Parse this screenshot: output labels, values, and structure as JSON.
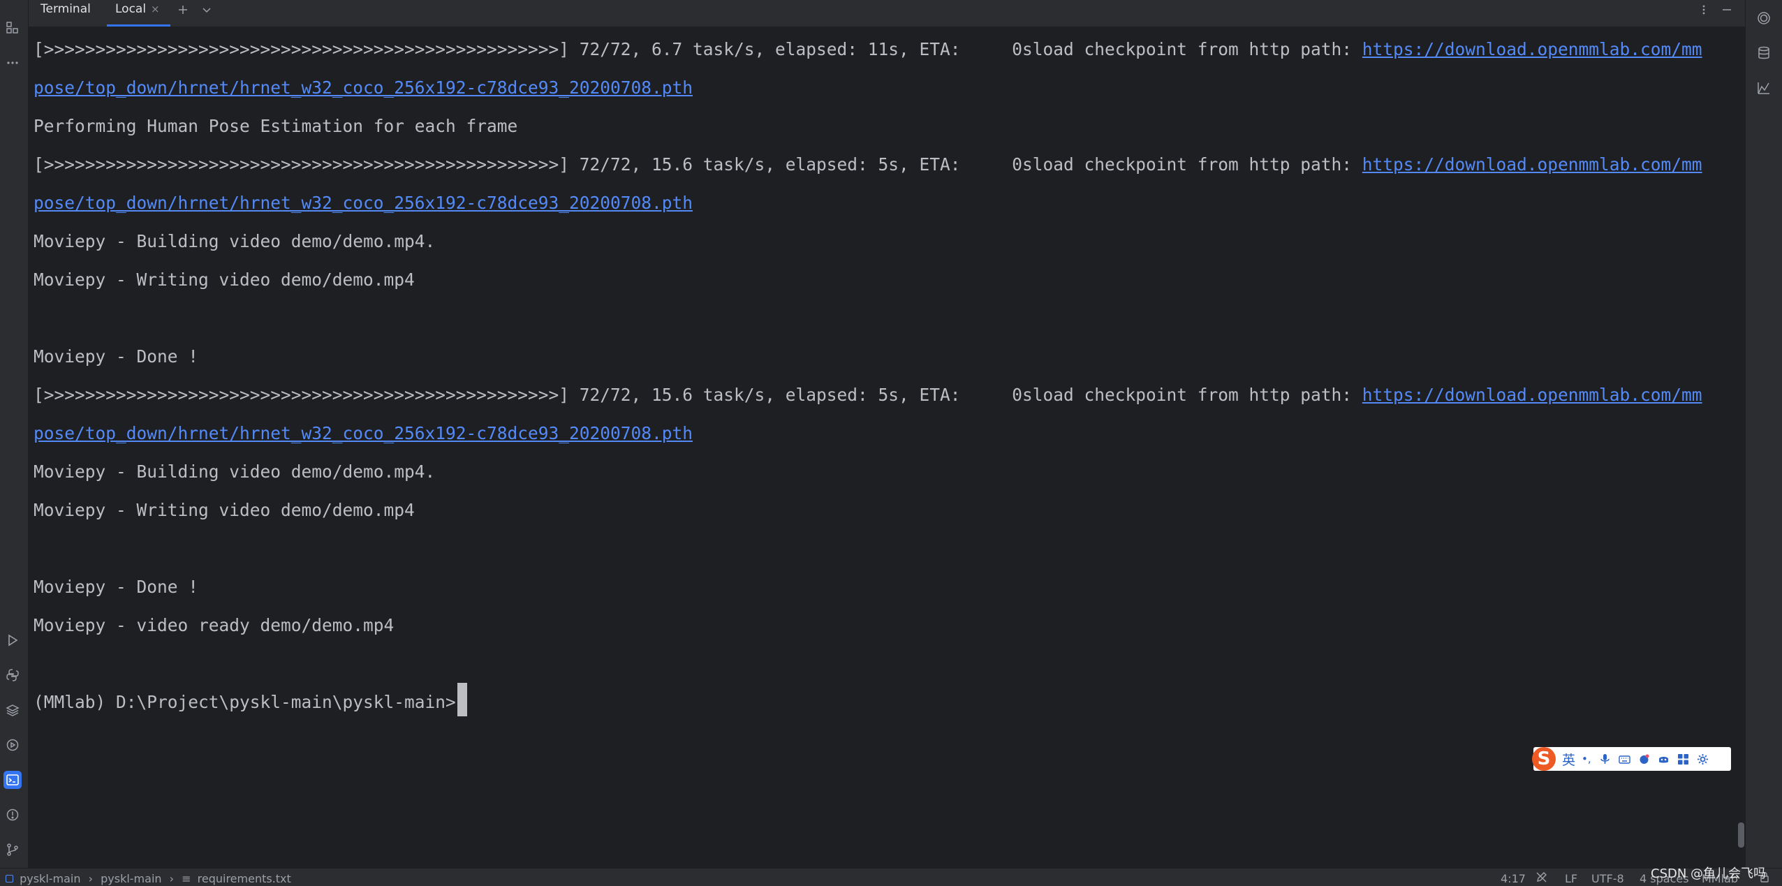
{
  "toolwindow": {
    "title": "Terminal",
    "tabs": [
      {
        "label": "Local",
        "close": "×"
      }
    ],
    "actions": {
      "new_tab": "+",
      "more": "⋮",
      "minimize": "—"
    }
  },
  "terminal": {
    "lines": [
      {
        "text": "[>>>>>>>>>>>>>>>>>>>>>>>>>>>>>>>>>>>>>>>>>>>>>>>>>>] 72/72, 6.7 task/s, elapsed: 11s, ETA:     0sload checkpoint from http path: ",
        "link": "https://download.openmmlab.com/mm"
      },
      {
        "text": "",
        "link": "pose/top_down/hrnet/hrnet_w32_coco_256x192-c78dce93_20200708.pth"
      },
      {
        "text": "Performing Human Pose Estimation for each frame",
        "link": ""
      },
      {
        "text": "[>>>>>>>>>>>>>>>>>>>>>>>>>>>>>>>>>>>>>>>>>>>>>>>>>>] 72/72, 15.6 task/s, elapsed: 5s, ETA:     0sload checkpoint from http path: ",
        "link": "https://download.openmmlab.com/mm"
      },
      {
        "text": "",
        "link": "pose/top_down/hrnet/hrnet_w32_coco_256x192-c78dce93_20200708.pth"
      },
      {
        "text": "Moviepy - Building video demo/demo.mp4.",
        "link": ""
      },
      {
        "text": "Moviepy - Writing video demo/demo.mp4",
        "link": ""
      },
      {
        "text": "",
        "link": ""
      },
      {
        "text": "Moviepy - Done !",
        "link": ""
      },
      {
        "text": "[>>>>>>>>>>>>>>>>>>>>>>>>>>>>>>>>>>>>>>>>>>>>>>>>>>] 72/72, 15.6 task/s, elapsed: 5s, ETA:     0sload checkpoint from http path: ",
        "link": "https://download.openmmlab.com/mm"
      },
      {
        "text": "",
        "link": "pose/top_down/hrnet/hrnet_w32_coco_256x192-c78dce93_20200708.pth"
      },
      {
        "text": "Moviepy - Building video demo/demo.mp4.",
        "link": ""
      },
      {
        "text": "Moviepy - Writing video demo/demo.mp4",
        "link": ""
      },
      {
        "text": "",
        "link": ""
      },
      {
        "text": "Moviepy - Done !",
        "link": ""
      },
      {
        "text": "Moviepy - video ready demo/demo.mp4",
        "link": ""
      },
      {
        "text": "",
        "link": ""
      },
      {
        "text": "(MMlab) D:\\Project\\pyskl-main\\pyskl-main>",
        "link": ""
      }
    ]
  },
  "ime": {
    "logo": "S",
    "lang": "英",
    "punct": "•,"
  },
  "statusbar": {
    "breadcrumb": [
      "pyskl-main",
      "pyskl-main",
      "requirements.txt"
    ],
    "separator": "›",
    "position": "4:17",
    "line_ending": "LF",
    "encoding": "UTF-8",
    "indent": "4 spaces",
    "interpreter": "MMlab"
  },
  "watermark": "CSDN @鱼儿会飞吗",
  "colors": {
    "accent": "#3574f0",
    "link": "#548af7",
    "background": "#1e1f22",
    "panel": "#2b2d30"
  }
}
